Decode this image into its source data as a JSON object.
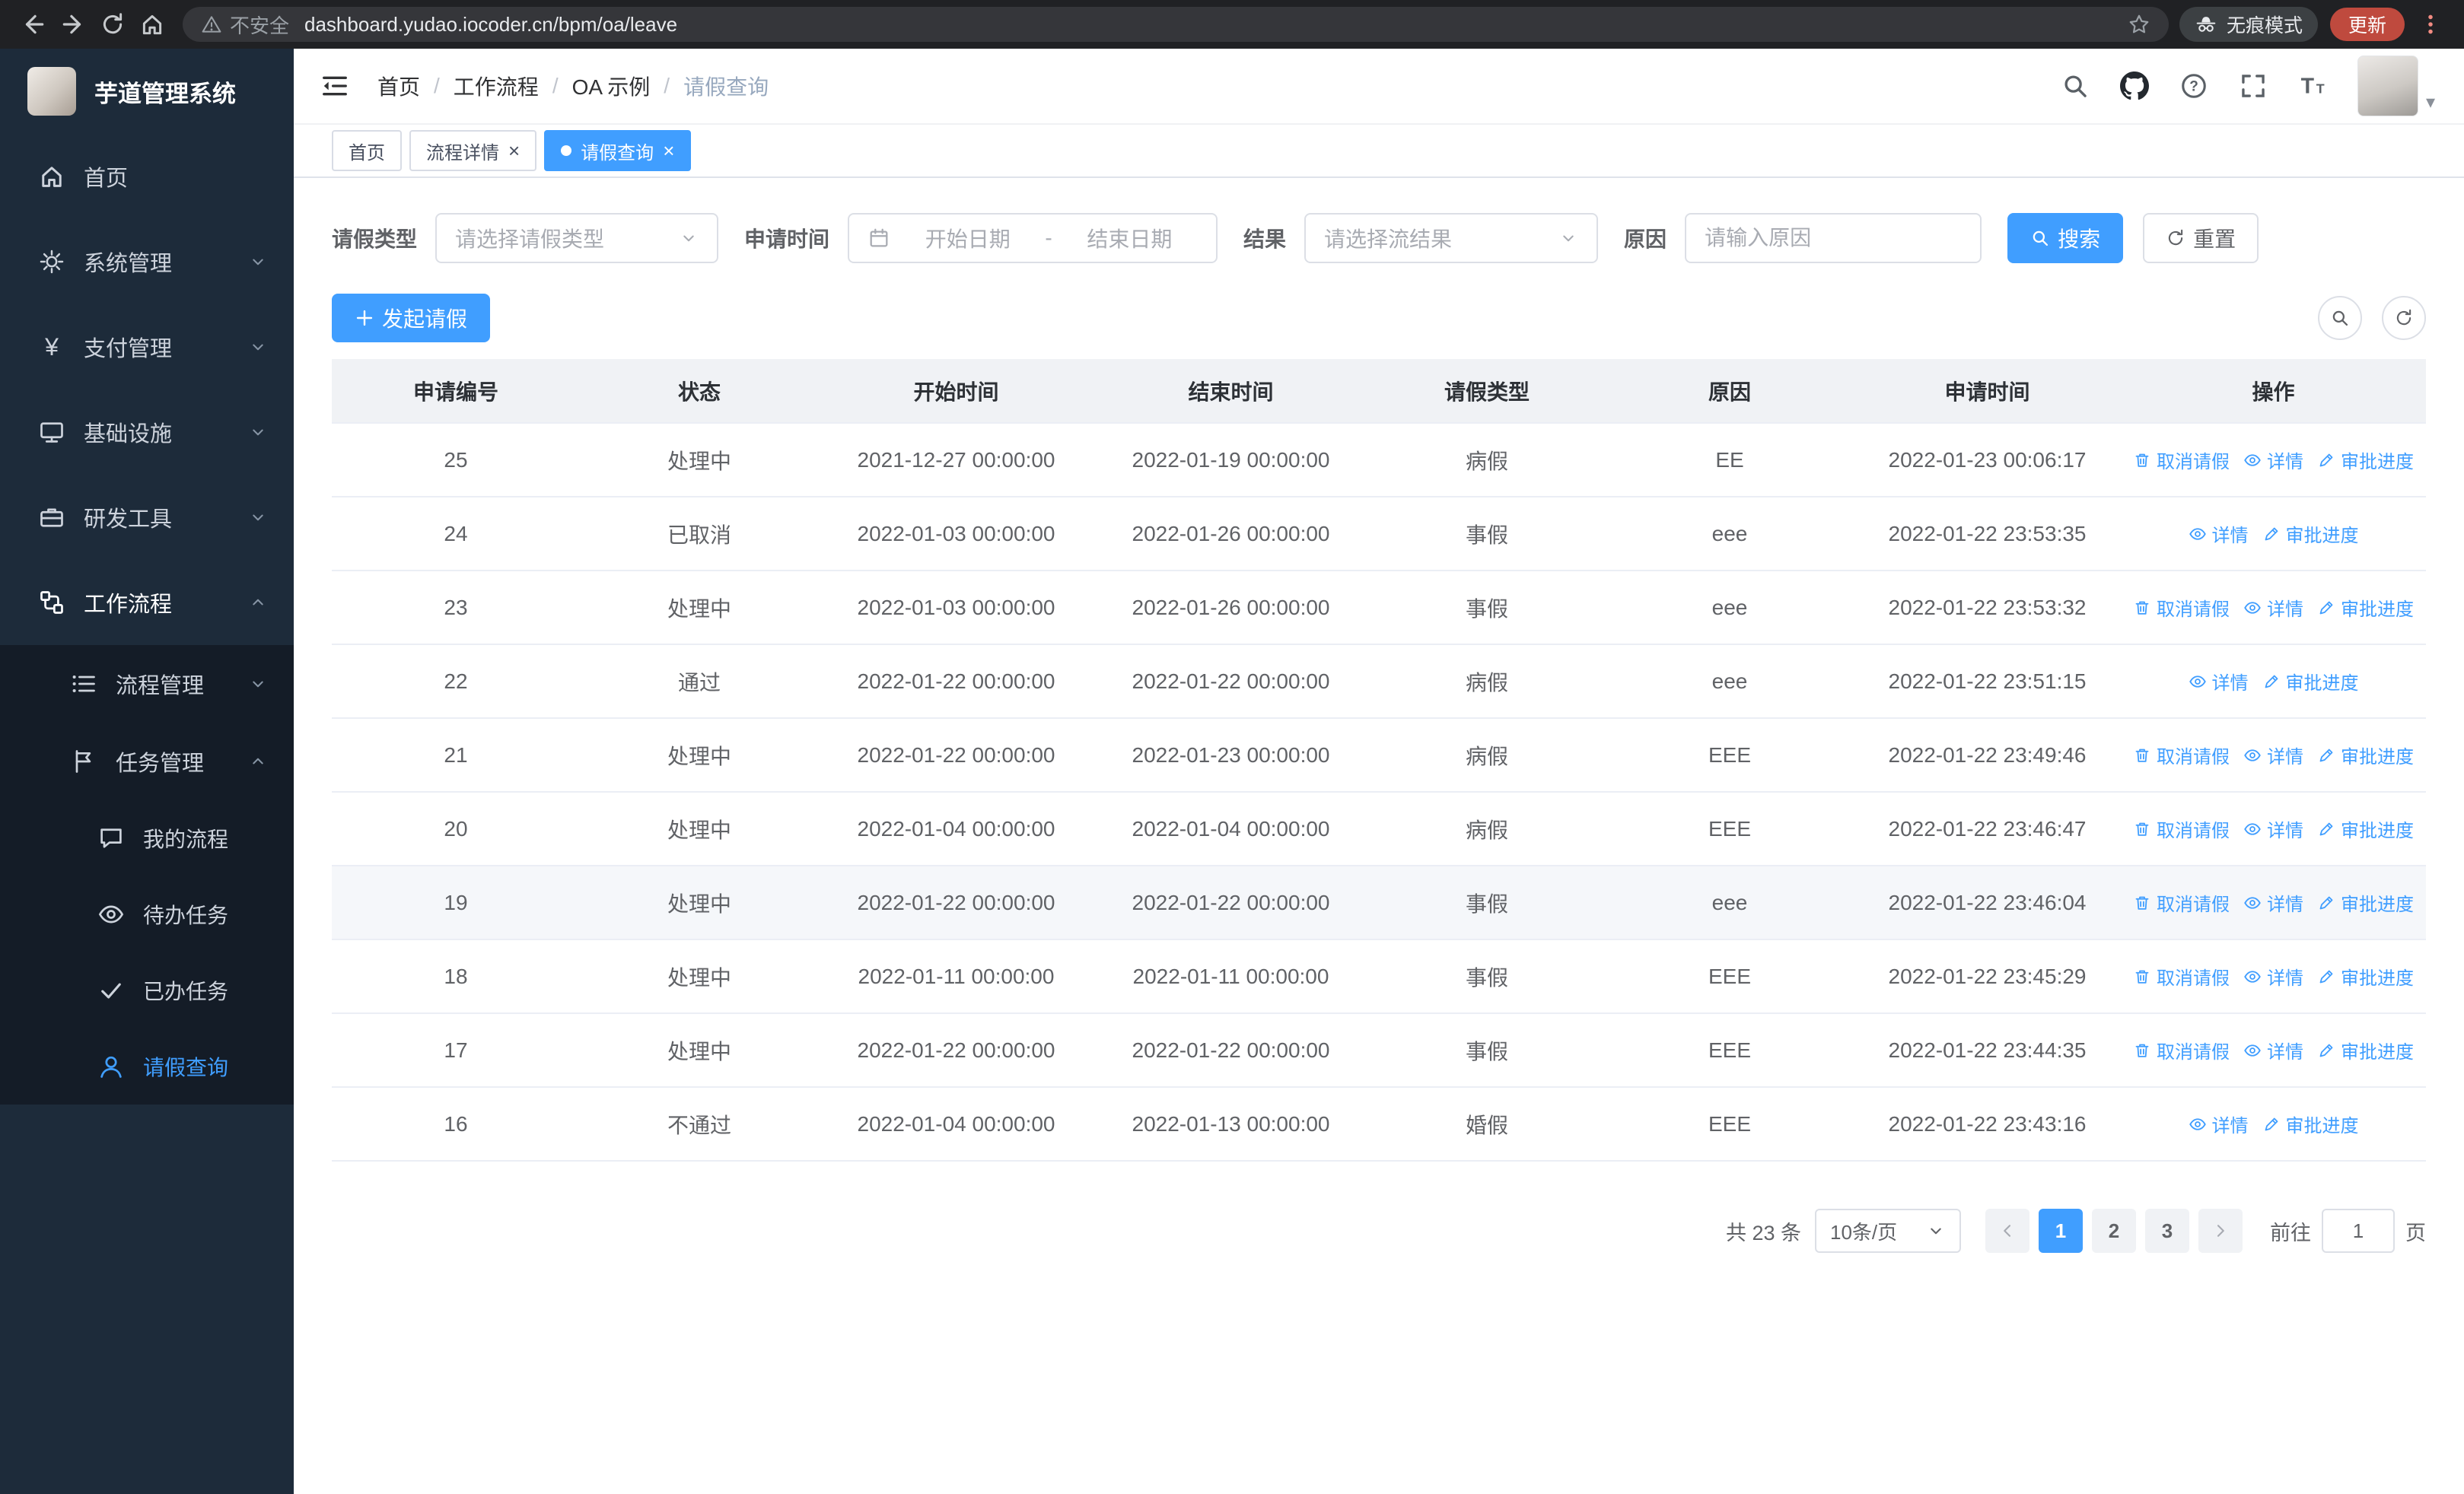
{
  "browser": {
    "security_text": "不安全",
    "url": "dashboard.yudao.iocoder.cn/bpm/oa/leave",
    "incognito_text": "无痕模式",
    "update_text": "更新"
  },
  "icons": {
    "close": "×",
    "caret": "▾"
  },
  "sidebar": {
    "logo_title": "芋道管理系统",
    "menu": {
      "home": "首页",
      "system": "系统管理",
      "payment": "支付管理",
      "infra": "基础设施",
      "devtools": "研发工具",
      "workflow": "工作流程",
      "process_mgmt": "流程管理",
      "task_mgmt": "任务管理",
      "my_process": "我的流程",
      "todo_tasks": "待办任务",
      "done_tasks": "已办任务",
      "leave_query": "请假查询"
    }
  },
  "header": {
    "breadcrumb": [
      "首页",
      "工作流程",
      "OA 示例",
      "请假查询"
    ],
    "separator": "/"
  },
  "tabs": [
    {
      "label": "首页"
    },
    {
      "label": "流程详情"
    },
    {
      "label": "请假查询"
    }
  ],
  "filters": {
    "leave_type_label": "请假类型",
    "leave_type_placeholder": "请选择请假类型",
    "time_label": "申请时间",
    "start_placeholder": "开始日期",
    "range_separator": "-",
    "end_placeholder": "结束日期",
    "result_label": "结果",
    "result_placeholder": "请选择流结果",
    "reason_label": "原因",
    "reason_placeholder": "请输入原因",
    "search_button": "搜索",
    "reset_button": "重置"
  },
  "toolbar": {
    "create_button": "发起请假"
  },
  "table": {
    "columns": [
      "申请编号",
      "状态",
      "开始时间",
      "结束时间",
      "请假类型",
      "原因",
      "申请时间",
      "操作"
    ],
    "action_labels": {
      "cancel": "取消请假",
      "detail": "详情",
      "progress": "审批进度"
    },
    "rows": [
      {
        "id": "25",
        "status": "处理中",
        "start": "2021-12-27 00:00:00",
        "end": "2022-01-19 00:00:00",
        "type": "病假",
        "reason": "EE",
        "applied": "2022-01-23 00:06:17",
        "actions": [
          "cancel",
          "detail",
          "progress"
        ],
        "highlight": false
      },
      {
        "id": "24",
        "status": "已取消",
        "start": "2022-01-03 00:00:00",
        "end": "2022-01-26 00:00:00",
        "type": "事假",
        "reason": "eee",
        "applied": "2022-01-22 23:53:35",
        "actions": [
          "detail",
          "progress"
        ],
        "highlight": false
      },
      {
        "id": "23",
        "status": "处理中",
        "start": "2022-01-03 00:00:00",
        "end": "2022-01-26 00:00:00",
        "type": "事假",
        "reason": "eee",
        "applied": "2022-01-22 23:53:32",
        "actions": [
          "cancel",
          "detail",
          "progress"
        ],
        "highlight": false
      },
      {
        "id": "22",
        "status": "通过",
        "start": "2022-01-22 00:00:00",
        "end": "2022-01-22 00:00:00",
        "type": "病假",
        "reason": "eee",
        "applied": "2022-01-22 23:51:15",
        "actions": [
          "detail",
          "progress"
        ],
        "highlight": false
      },
      {
        "id": "21",
        "status": "处理中",
        "start": "2022-01-22 00:00:00",
        "end": "2022-01-23 00:00:00",
        "type": "病假",
        "reason": "EEE",
        "applied": "2022-01-22 23:49:46",
        "actions": [
          "cancel",
          "detail",
          "progress"
        ],
        "highlight": false
      },
      {
        "id": "20",
        "status": "处理中",
        "start": "2022-01-04 00:00:00",
        "end": "2022-01-04 00:00:00",
        "type": "病假",
        "reason": "EEE",
        "applied": "2022-01-22 23:46:47",
        "actions": [
          "cancel",
          "detail",
          "progress"
        ],
        "highlight": false
      },
      {
        "id": "19",
        "status": "处理中",
        "start": "2022-01-22 00:00:00",
        "end": "2022-01-22 00:00:00",
        "type": "事假",
        "reason": "eee",
        "applied": "2022-01-22 23:46:04",
        "actions": [
          "cancel",
          "detail",
          "progress"
        ],
        "highlight": true
      },
      {
        "id": "18",
        "status": "处理中",
        "start": "2022-01-11 00:00:00",
        "end": "2022-01-11 00:00:00",
        "type": "事假",
        "reason": "EEE",
        "applied": "2022-01-22 23:45:29",
        "actions": [
          "cancel",
          "detail",
          "progress"
        ],
        "highlight": false
      },
      {
        "id": "17",
        "status": "处理中",
        "start": "2022-01-22 00:00:00",
        "end": "2022-01-22 00:00:00",
        "type": "事假",
        "reason": "EEE",
        "applied": "2022-01-22 23:44:35",
        "actions": [
          "cancel",
          "detail",
          "progress"
        ],
        "highlight": false
      },
      {
        "id": "16",
        "status": "不通过",
        "start": "2022-01-04 00:00:00",
        "end": "2022-01-13 00:00:00",
        "type": "婚假",
        "reason": "EEE",
        "applied": "2022-01-22 23:43:16",
        "actions": [
          "detail",
          "progress"
        ],
        "highlight": false
      }
    ]
  },
  "pagination": {
    "total_text": "共 23 条",
    "page_size": "10条/页",
    "pages": [
      "1",
      "2",
      "3"
    ],
    "active_page": "1",
    "goto_prefix": "前往",
    "goto_value": "1",
    "goto_suffix": "页"
  },
  "colors": {
    "primary": "#409eff",
    "sidebar_bg": "#1d2b3a",
    "submenu_bg": "#141c27",
    "table_header_bg": "#f0f2f5"
  }
}
